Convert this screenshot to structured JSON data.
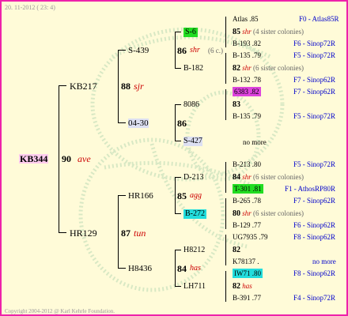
{
  "header": {
    "date_text": "20. 11-2012 ( 23: 4)"
  },
  "footer": {
    "copyright": "Copyright 2004-2012 @ Karl Kehrle Foundation."
  },
  "colors": {
    "border": "#ee22aa",
    "background": "#fffbd8",
    "green": "#22dd22",
    "cyan": "#22dddd",
    "magenta": "#dd44dd",
    "queen_text": "#cc0000",
    "region_text": "#0000cc"
  },
  "root": {
    "name": "KB344",
    "num": "90",
    "queen": "ave"
  },
  "level1": [
    {
      "name": "KB217",
      "num": "88",
      "queen": "sjr"
    },
    {
      "name": "HR129",
      "num": "87",
      "queen": "tun"
    }
  ],
  "level2": [
    {
      "name": "S-439",
      "num": "86",
      "queen": "shr",
      "extra": "(6 c.)"
    },
    {
      "name": "04-30",
      "num": "86"
    },
    {
      "name": "HR166",
      "num": "85",
      "queen": "agg"
    },
    {
      "name": "H8436",
      "num": "84",
      "queen": "has"
    }
  ],
  "level3": [
    {
      "name": "S-6"
    },
    {
      "name": "B-182"
    },
    {
      "name": "8086"
    },
    {
      "name": "S-427"
    },
    {
      "name": "D-213"
    },
    {
      "name": "B-272"
    },
    {
      "name": "H8212"
    },
    {
      "name": "LH711"
    }
  ],
  "level4": [
    {
      "top": "Atlas .85",
      "top_region": "F0 - Atlas85R",
      "num": "85",
      "queen": "shr",
      "colonies": "(4 sister colonies)",
      "bottom": "B-193 .82",
      "bottom_region": "F6 - Sinop72R"
    },
    {
      "top": "B-135 .79",
      "top_region": "F5 - Sinop72R",
      "num": "82",
      "queen": "shr",
      "colonies": "(6 sister colonies)",
      "bottom": "B-132 .78",
      "bottom_region": "F7 - Sinop62R"
    },
    {
      "top": "6383 .82",
      "top_region": "F7 - Sinop62R",
      "num": "83",
      "bottom": "B-135 .79",
      "bottom_region": "F5 - Sinop72R"
    },
    {
      "no_more": "no more"
    },
    {
      "top": "B-213 .80",
      "top_region": "F5 - Sinop72R",
      "num": "84",
      "queen": "shr",
      "colonies": "(6 sister colonies)",
      "bottom": "T-301 .81",
      "bottom_region": "F1 - AthosRP80R"
    },
    {
      "top": "B-265 .78",
      "top_region": "F7 - Sinop62R",
      "num": "80",
      "queen": "shr",
      "colonies": "(6 sister colonies)",
      "bottom": "B-129 .77",
      "bottom_region": "F6 - Sinop62R"
    },
    {
      "top": "UG7935 .79",
      "top_region": "F8 - Sinop62R",
      "num": "82",
      "bottom": "K78137 .",
      "bottom_region": "no more"
    },
    {
      "top": "IW71 .80",
      "top_region": "F8 - Sinop62R",
      "num": "82",
      "queen": "has",
      "bottom": "B-391 .77",
      "bottom_region": "F4 - Sinop72R"
    }
  ]
}
